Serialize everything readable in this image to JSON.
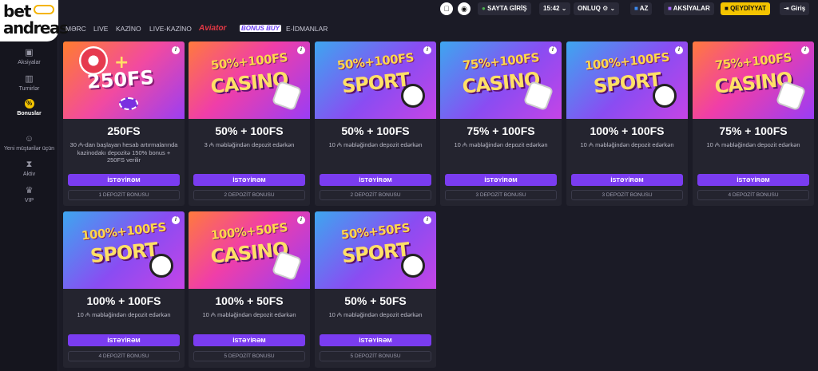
{
  "brand": {
    "line1": "bet",
    "line2": "andreas"
  },
  "sidebar": {
    "items": [
      {
        "label": "Aksiyalar",
        "icon": "gift-icon"
      },
      {
        "label": "Turnirlər",
        "icon": "trophy-icon"
      },
      {
        "label": "Bonuslar",
        "icon": "percent-icon",
        "active": true
      },
      {
        "label": "Yeni müştərilər üçün",
        "icon": "user-plus-icon"
      },
      {
        "label": "Aktiv",
        "icon": "hourglass-icon"
      },
      {
        "label": "VIP",
        "icon": "crown-icon"
      }
    ]
  },
  "topbar": {
    "apple": "",
    "android": "",
    "site_login": "SAYTA GİRİŞ",
    "time": "15:42",
    "odds": "ONLUQ",
    "lang": "AZ",
    "promotions": "AKSİYALAR",
    "register": "QEYDİYYAT",
    "login": "Giriş"
  },
  "nav": [
    "MƏRC",
    "LIVE",
    "KAZİNO",
    "LIVE-KAZİNO",
    "Aviator",
    "BONUS BUY",
    "E-İDMANLAR"
  ],
  "cards": [
    {
      "banner": "fs250",
      "promo": "250FS",
      "word": "",
      "title": "250FS",
      "desc": "30 ₼-dan başlayan hesab artırmalarında kazinodakı depozitə 150% bonus + 250FS verilir",
      "button": "İSTƏYİRƏM",
      "badge": "1 DEPOZİT BONUSU"
    },
    {
      "banner": "casino",
      "promo": "50%+100FS",
      "word": "CASINO",
      "title": "50% + 100FS",
      "desc": "3 ₼ məbləğindən depozit edərkən",
      "button": "İSTƏYİRƏM",
      "badge": "2 DEPOZİT BONUSU"
    },
    {
      "banner": "sport",
      "promo": "50%+100FS",
      "word": "SPORT",
      "title": "50% + 100FS",
      "desc": "10 ₼ məbləğindən depozit edərkən",
      "button": "İSTƏYİRƏM",
      "badge": "2 DEPOZİT BONUSU"
    },
    {
      "banner": "sport",
      "promo": "75%+100FS",
      "word": "CASINO",
      "title": "75% + 100FS",
      "desc": "10 ₼ məbləğindən depozit edərkən",
      "button": "İSTƏYİRƏM",
      "badge": "3 DEPOZİT BONUSU"
    },
    {
      "banner": "sport",
      "promo": "100%+100FS",
      "word": "SPORT",
      "title": "100% + 100FS",
      "desc": "10 ₼ məbləğindən depozit edərkən",
      "button": "İSTƏYİRƏM",
      "badge": "3 DEPOZİT BONUSU"
    },
    {
      "banner": "casino",
      "promo": "75%+100FS",
      "word": "CASINO",
      "title": "75% + 100FS",
      "desc": "10 ₼ məbləğindən depozit edərkən",
      "button": "İSTƏYİRƏM",
      "badge": "4 DEPOZİT BONUSU"
    },
    {
      "banner": "sport",
      "promo": "100%+100FS",
      "word": "SPORT",
      "title": "100% + 100FS",
      "desc": "10 ₼ məbləğindən depozit edərkən",
      "button": "İSTƏYİRƏM",
      "badge": "4 DEPOZİT BONUSU"
    },
    {
      "banner": "casino",
      "promo": "100%+50FS",
      "word": "CASINO",
      "title": "100% + 50FS",
      "desc": "10 ₼ məbləğindən depozit edərkən",
      "button": "İSTƏYİRƏM",
      "badge": "5 DEPOZİT BONUSU"
    },
    {
      "banner": "sport",
      "promo": "50%+50FS",
      "word": "SPORT",
      "title": "50% + 50FS",
      "desc": "10 ₼ məbləğindən depozit edərkən",
      "button": "İSTƏYİRƏM",
      "badge": "5 DEPOZİT BONUSU"
    }
  ],
  "colors": {
    "accent_purple": "#7a3cf0",
    "accent_yellow": "#f4c400",
    "background": "#1b1b26"
  }
}
